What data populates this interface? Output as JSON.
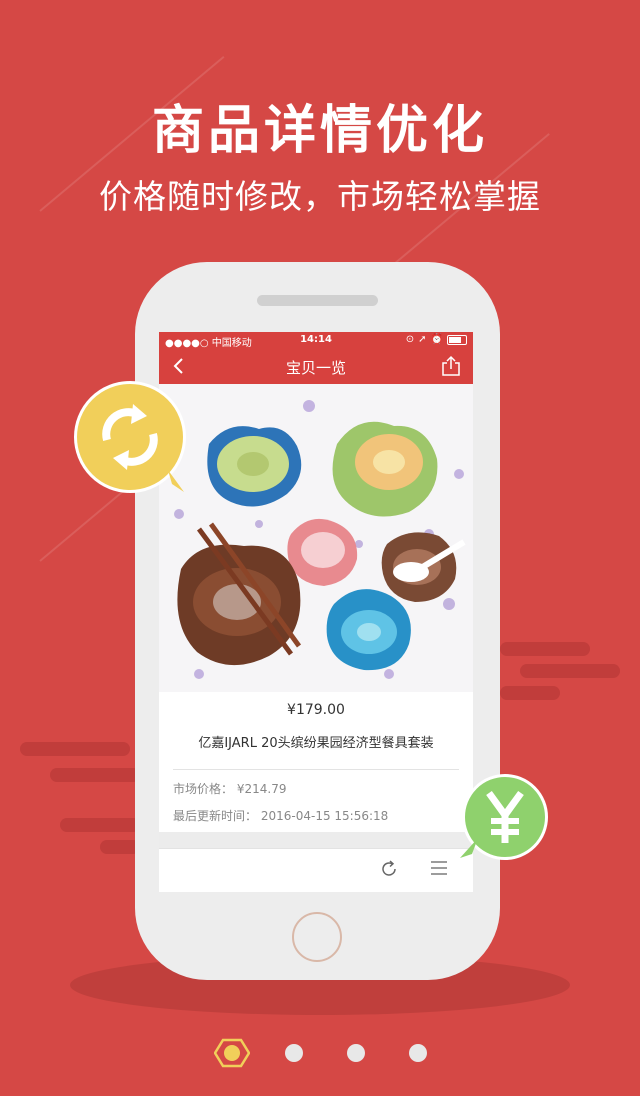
{
  "banner": {
    "headline": "商品详情优化",
    "subline": "价格随时修改，市场轻松掌握"
  },
  "status_bar": {
    "carrier": "●●●●○ 中国移动",
    "time": "14:14"
  },
  "nav": {
    "title": "宝贝一览"
  },
  "product": {
    "price": "¥179.00",
    "name": "亿嘉IJARL 20头缤纷果园经济型餐具套装",
    "market_price_label": "市场价格：",
    "market_price_value": "¥214.79",
    "updated_label": "最后更新时间：",
    "updated_value": "2016-04-15 15:56:18"
  },
  "icons": {
    "sync_bubble": "sync-arrows-icon",
    "currency_bubble": "yuan-icon",
    "refresh": "refresh-icon",
    "menu": "menu-icon",
    "back": "chevron-left-icon",
    "share": "share-icon"
  },
  "colors": {
    "background": "#d54845",
    "accent_red": "#d7413e",
    "bubble_yellow": "#f1cf5a",
    "bubble_green": "#8fd16d"
  },
  "pagination": {
    "current": 1,
    "total": 4
  }
}
